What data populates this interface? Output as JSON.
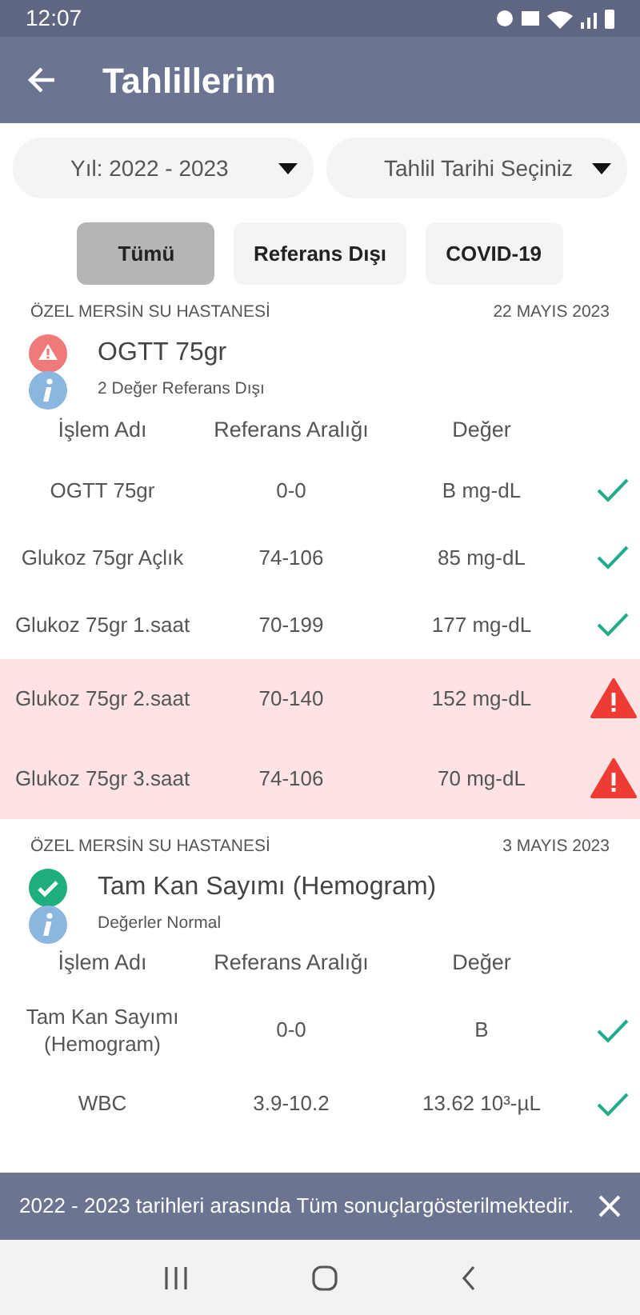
{
  "status_bar": {
    "time": "12:07"
  },
  "app_bar": {
    "title": "Tahlillerim"
  },
  "dropdowns": [
    {
      "label": "Yıl: 2022 - 2023"
    },
    {
      "label": "Tahlil Tarihi Seçiniz"
    }
  ],
  "filters": [
    {
      "label": "Tümü",
      "selected": true
    },
    {
      "label": "Referans Dışı",
      "selected": false
    },
    {
      "label": "COVID-19",
      "selected": false
    }
  ],
  "results": [
    {
      "hospital": "ÖZEL MERSİN SU HASTANESİ",
      "date": "22 MAYIS 2023",
      "title": "OGTT 75gr",
      "kind": "warning",
      "summary": "2 Değer Referans Dışı",
      "columns": [
        "İşlem Adı",
        "Referans Aralığı",
        "Değer"
      ],
      "rows": [
        {
          "name": "OGTT 75gr",
          "range": "0-0",
          "value": "B mg-dL",
          "out_of_range": false
        },
        {
          "name": "Glukoz 75gr Açlık",
          "range": "74-106",
          "value": "85 mg-dL",
          "out_of_range": false
        },
        {
          "name": "Glukoz 75gr 1.saat",
          "range": "70-199",
          "value": "177 mg-dL",
          "out_of_range": false
        },
        {
          "name": "Glukoz 75gr 2.saat",
          "range": "70-140",
          "value": "152 mg-dL",
          "out_of_range": true
        },
        {
          "name": "Glukoz 75gr 3.saat",
          "range": "74-106",
          "value": "70 mg-dL",
          "out_of_range": true
        }
      ]
    },
    {
      "hospital": "ÖZEL MERSİN SU HASTANESİ",
      "date": "3 MAYIS 2023",
      "title": "Tam Kan Sayımı (Hemogram)",
      "kind": "ok",
      "summary": "Değerler Normal",
      "columns": [
        "İşlem Adı",
        "Referans Aralığı",
        "Değer"
      ],
      "rows": [
        {
          "name": "Tam Kan Sayımı (Hemogram)",
          "range": "0-0",
          "value": "B",
          "out_of_range": false
        },
        {
          "name": "WBC",
          "range": "3.9-10.2",
          "value": "13.62 10³-µL",
          "out_of_range": false
        }
      ]
    }
  ],
  "snackbar": {
    "message": "2022 - 2023 tarihleri arasında Tüm sonuçlargösterilmektedir."
  }
}
